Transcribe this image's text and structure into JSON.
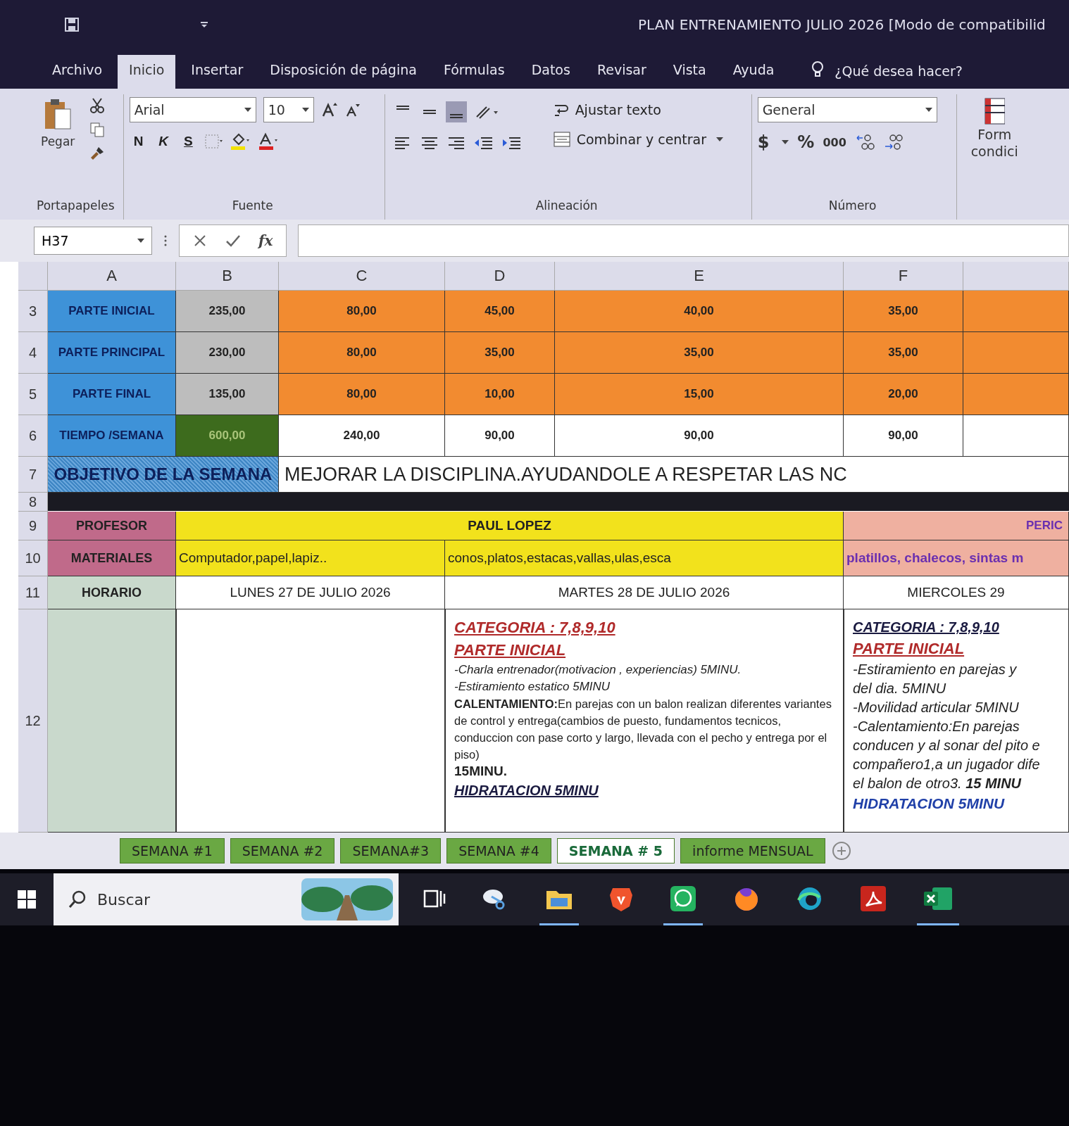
{
  "window": {
    "title": "PLAN ENTRENAMIENTO JULIO 2026  [Modo de compatibilid"
  },
  "ribbon_tabs": [
    {
      "label": "Archivo",
      "selected": false
    },
    {
      "label": "Inicio",
      "selected": true
    },
    {
      "label": "Insertar",
      "selected": false
    },
    {
      "label": "Disposición de página",
      "selected": false
    },
    {
      "label": "Fórmulas",
      "selected": false
    },
    {
      "label": "Datos",
      "selected": false
    },
    {
      "label": "Revisar",
      "selected": false
    },
    {
      "label": "Vista",
      "selected": false
    },
    {
      "label": "Ayuda",
      "selected": false
    }
  ],
  "tell_me": "¿Qué desea hacer?",
  "ribbon": {
    "clipboard": {
      "paste": "Pegar",
      "group": "Portapapeles"
    },
    "font": {
      "family": "Arial",
      "size": "10",
      "bold": "N",
      "italic": "K",
      "underline": "S",
      "group": "Fuente"
    },
    "alignment": {
      "wrap": "Ajustar texto",
      "merge": "Combinar y centrar",
      "group": "Alineación"
    },
    "number": {
      "format": "General",
      "currency": "$",
      "percent": "%",
      "thousands": "000",
      "group": "Número"
    },
    "styles": {
      "line_1": "Form",
      "line_2": "condici"
    }
  },
  "formula_bar": {
    "name_box": "H37",
    "function_label": "fx"
  },
  "sheet": {
    "columns": [
      "A",
      "B",
      "C",
      "D",
      "E",
      "F"
    ],
    "summary_rows": [
      {
        "number": "3",
        "kind": "phase",
        "label": "PARTE INICIAL",
        "cells": [
          "235,00",
          "80,00",
          "45,00",
          "40,00",
          "35,00"
        ]
      },
      {
        "number": "4",
        "kind": "phase",
        "label": "PARTE PRINCIPAL",
        "cells": [
          "230,00",
          "80,00",
          "35,00",
          "35,00",
          "35,00"
        ]
      },
      {
        "number": "5",
        "kind": "phase",
        "label": "PARTE FINAL",
        "cells": [
          "135,00",
          "80,00",
          "10,00",
          "15,00",
          "20,00"
        ]
      },
      {
        "number": "6",
        "kind": "total",
        "label": "TIEMPO /SEMANA",
        "cells": [
          "600,00",
          "240,00",
          "90,00",
          "90,00",
          "90,00"
        ]
      }
    ],
    "objective": {
      "number": "7",
      "band_number": "8",
      "label": "OBJETIVO DE LA SEMANA",
      "text": "MEJORAR LA DISCIPLINA.AYUDANDOLE A RESPETAR LAS NC"
    },
    "teacher": {
      "number": "9",
      "label": "PROFESOR",
      "name": "PAUL LOPEZ",
      "side": "PERIC"
    },
    "materials": {
      "number": "10",
      "label": "MATERIALES",
      "items": [
        "Computador,papel,lapiz..",
        "conos,platos,estacas,vallas,ulas,esca",
        "platillos, chalecos, sintas m"
      ]
    },
    "schedule": {
      "number": "11",
      "label": "HORARIO",
      "days": [
        "LUNES 27 DE JULIO 2026",
        "MARTES 28 DE JULIO 2026",
        "MIERCOLES 29"
      ]
    },
    "plans": {
      "number": "12",
      "days": [
        {
          "lines": [
            {
              "kind": "title",
              "text": "CATEGORIA : 7,8,9,10"
            },
            {
              "kind": "title",
              "text": "PARTE INICIAL"
            },
            {
              "kind": "item",
              "text": "-Charla entrenador(motivacion , experiencias) 5MINU."
            },
            {
              "kind": "item",
              "text": "-Estiramiento estatico 5MINU"
            },
            {
              "kind": "body",
              "text": "**CALENTAMIENTO:**En parejas con un balon realizan diferentes variantes de control y entrega(cambios de puesto, fundamentos tecnicos, conduccion con pase corto y largo, llevada con el pecho y entrega por el piso)"
            },
            {
              "kind": "total",
              "text": "15MINU."
            },
            {
              "kind": "subtitle",
              "text": "HIDRATACION 5MINU"
            }
          ]
        },
        {
          "lines": [
            {
              "kind": "subtitle",
              "text": "CATEGORIA : 7,8,9,10"
            },
            {
              "kind": "title",
              "text": "PARTE INICIAL"
            },
            {
              "kind": "item",
              "text": "-Estiramiento en parejas  y"
            },
            {
              "kind": "item",
              "text": "del dia. 5MINU"
            },
            {
              "kind": "item",
              "text": "-Movilidad articular 5MINU"
            },
            {
              "kind": "item",
              "text": "-Calentamiento:En parejas"
            },
            {
              "kind": "item",
              "text": "conducen y al sonar del pito e"
            },
            {
              "kind": "item",
              "text": "compañero1,a un jugador dife"
            },
            {
              "kind": "item",
              "text": "el balon de otro3. **15 MINU**"
            },
            {
              "kind": "water",
              "text": "HIDRATACION 5MINU"
            }
          ]
        }
      ]
    }
  },
  "sheet_tabs": [
    {
      "label": "SEMANA #1",
      "selected": false
    },
    {
      "label": "SEMANA #2",
      "selected": false
    },
    {
      "label": "SEMANA#3",
      "selected": false
    },
    {
      "label": "SEMANA #4",
      "selected": false
    },
    {
      "label": "SEMANA # 5",
      "selected": true
    },
    {
      "label": "informe MENSUAL",
      "selected": false
    }
  ],
  "taskbar": {
    "search_placeholder": "Buscar",
    "apps": [
      {
        "kind": "taskview",
        "running": false
      },
      {
        "kind": "snip",
        "running": false
      },
      {
        "kind": "folder",
        "running": true
      },
      {
        "kind": "lion",
        "running": false
      },
      {
        "kind": "chat",
        "running": true
      },
      {
        "kind": "fox",
        "running": false
      },
      {
        "kind": "swirl",
        "running": false
      },
      {
        "kind": "pdf",
        "running": false
      },
      {
        "kind": "sheet",
        "running": true
      }
    ]
  }
}
